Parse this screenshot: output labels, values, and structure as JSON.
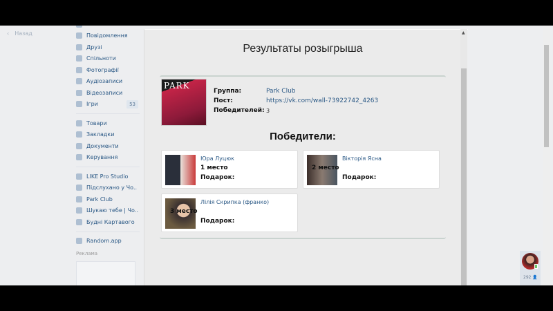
{
  "sidebar": {
    "back_label": "Назад",
    "items": [
      {
        "label": "Повідомлення",
        "icon": "message-icon"
      },
      {
        "label": "Друзі",
        "icon": "user-icon"
      },
      {
        "label": "Спільноти",
        "icon": "users-icon"
      },
      {
        "label": "Фотографії",
        "icon": "camera-icon"
      },
      {
        "label": "Аудіозаписи",
        "icon": "music-icon"
      },
      {
        "label": "Відеозаписи",
        "icon": "video-icon"
      },
      {
        "label": "Ігри",
        "icon": "gamepad-icon",
        "badge": "53"
      }
    ],
    "items2": [
      {
        "label": "Товари",
        "icon": "bag-icon"
      },
      {
        "label": "Закладки",
        "icon": "star-icon"
      },
      {
        "label": "Документи",
        "icon": "document-icon"
      },
      {
        "label": "Керування",
        "icon": "gamepad-icon"
      }
    ],
    "groups": [
      "LIKE Pro Studio",
      "Підслухано у Чо..",
      "Park Club",
      "Шукаю тебе | Чо..",
      "Будні Картавого"
    ],
    "app": "Random.app",
    "ad_label": "Реклама"
  },
  "main": {
    "title": "Результаты розыгрыша",
    "cover_text": "PARK",
    "group_label": "Группа:",
    "group_value": "Park Club",
    "post_label": "Пост:",
    "post_value": "https://vk.com/wall-73922742_4263",
    "winners_label": "Победителей:",
    "winners_value": "3",
    "winners_heading": "Победители:",
    "winners": [
      {
        "name": "Юра Луцюк",
        "place": "1 место",
        "gift": "Подарок:"
      },
      {
        "name": "Вікторія Ясна",
        "place": "2 место",
        "gift": "Подарок:"
      },
      {
        "name": "Лілія Скрипка (франко)",
        "place": "3 место",
        "gift": "Подарок:"
      }
    ]
  },
  "chat": {
    "count": "292"
  }
}
